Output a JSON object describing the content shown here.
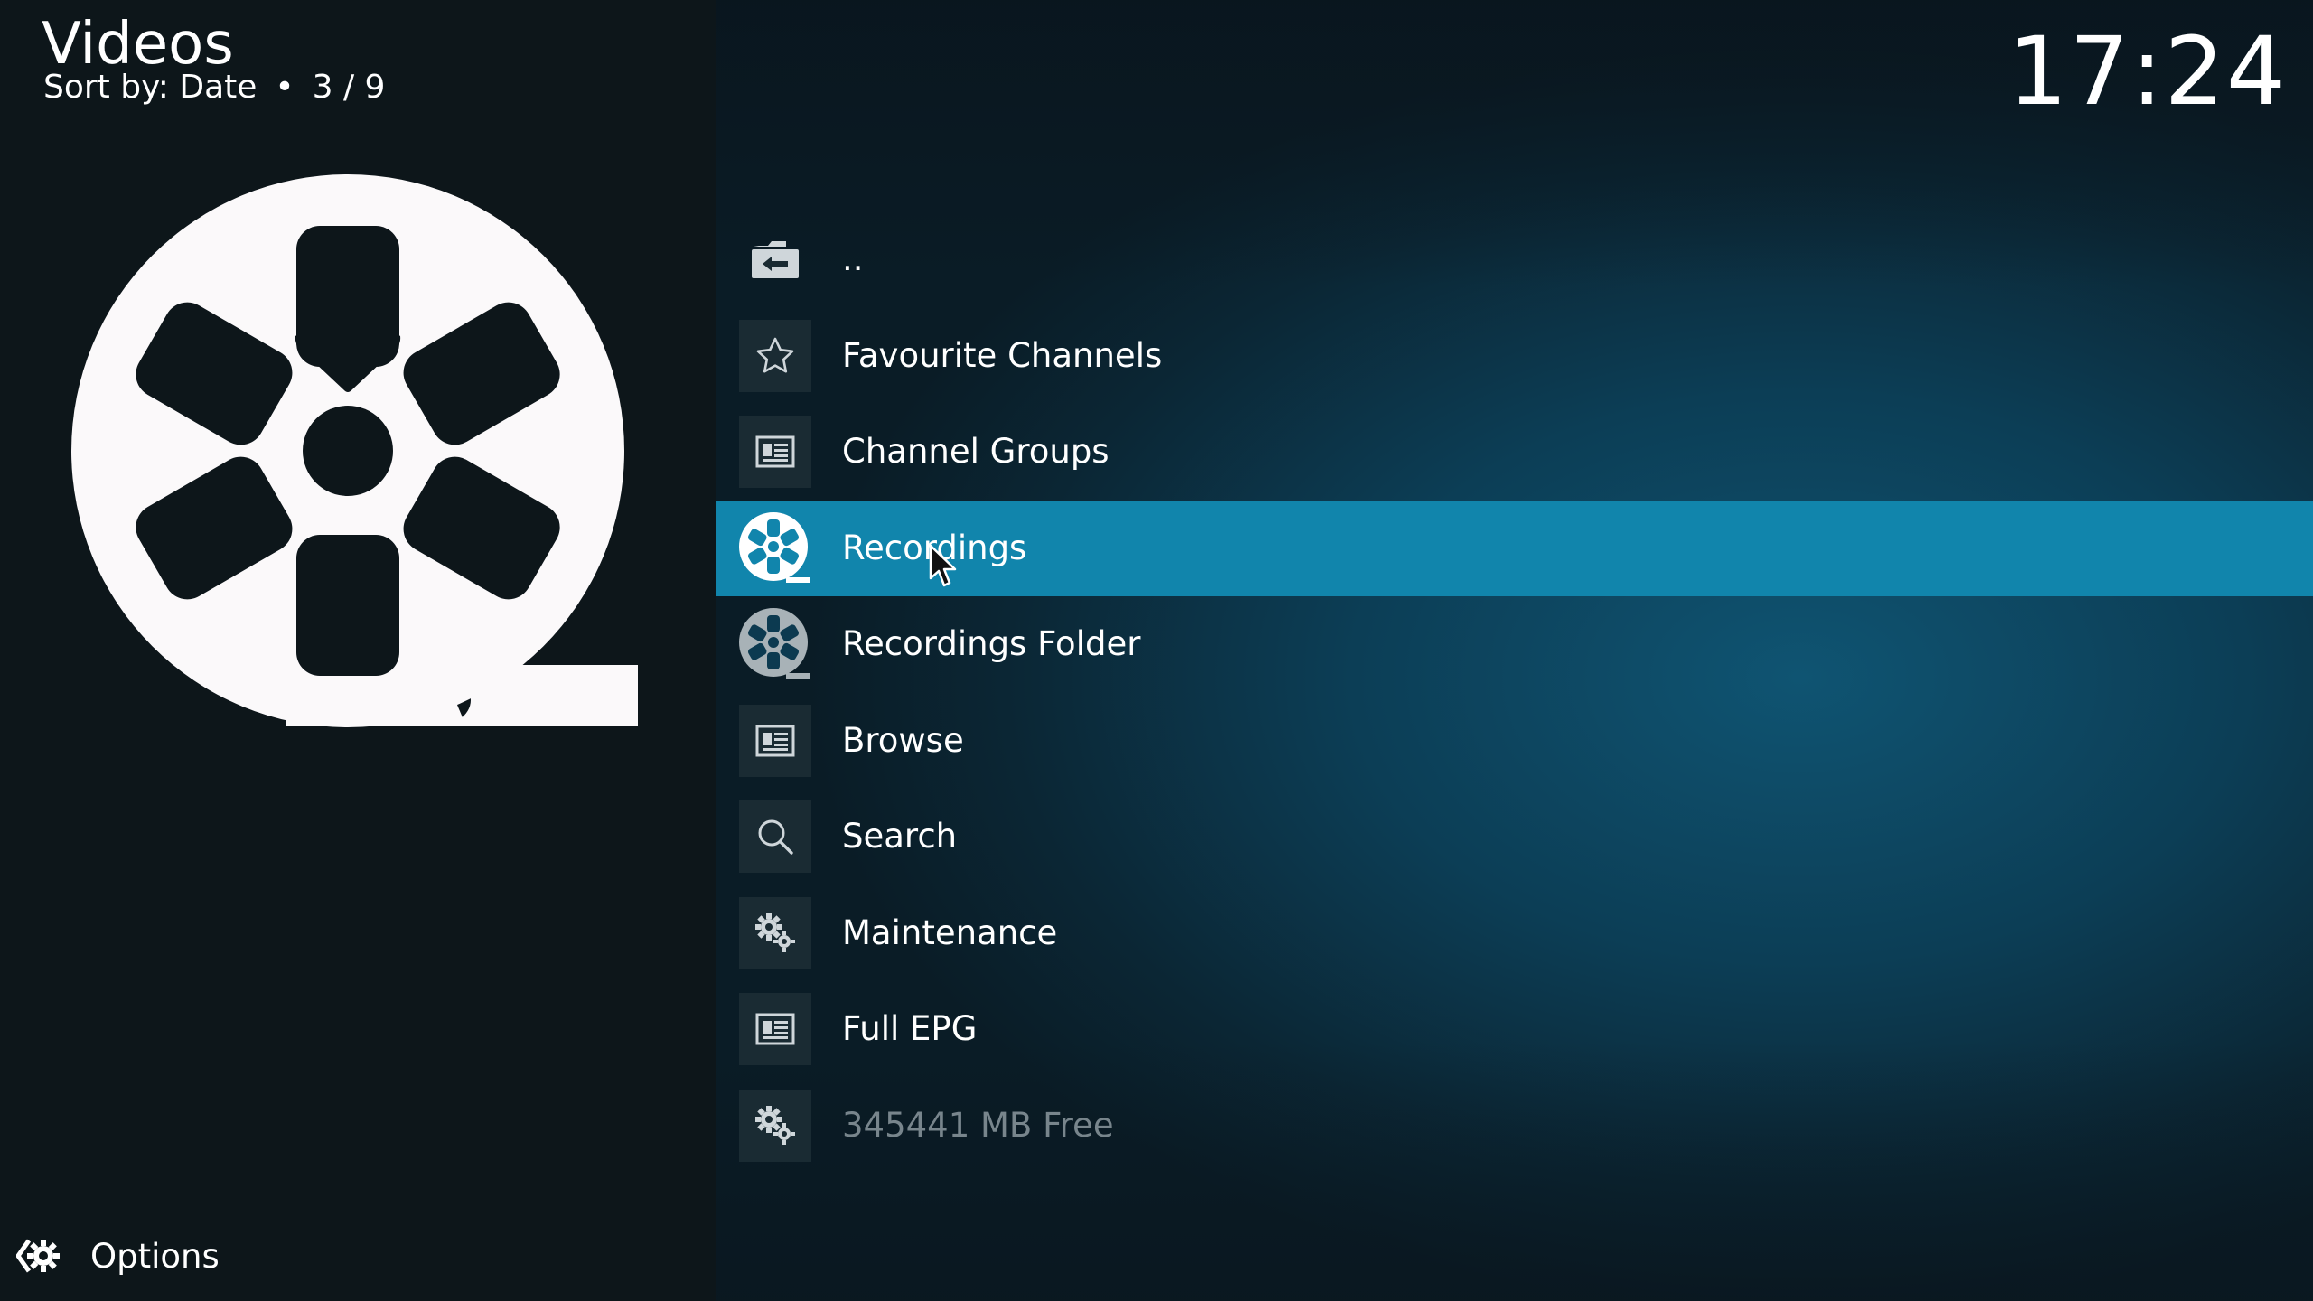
{
  "header": {
    "title": "Videos",
    "sort_label": "Sort by: Date",
    "separator": "•",
    "position": "3 / 9",
    "clock": "17:24"
  },
  "list": {
    "items": [
      {
        "label": "..",
        "icon": "folder-back-icon"
      },
      {
        "label": "Favourite Channels",
        "icon": "star-icon"
      },
      {
        "label": "Channel Groups",
        "icon": "list-icon"
      },
      {
        "label": "Recordings",
        "icon": "film-reel-icon",
        "selected": true
      },
      {
        "label": "Recordings Folder",
        "icon": "film-reel-icon"
      },
      {
        "label": "Browse",
        "icon": "list-icon"
      },
      {
        "label": "Search",
        "icon": "search-icon"
      },
      {
        "label": "Maintenance",
        "icon": "gears-icon"
      },
      {
        "label": "Full EPG",
        "icon": "list-icon"
      },
      {
        "label": "345441 MB Free",
        "icon": "gears-icon",
        "dimmed": true
      }
    ]
  },
  "footer": {
    "options_label": "Options"
  },
  "colors": {
    "selection": "#1185ac",
    "left_panel": "#0d161a",
    "dim_text": "#78858c"
  }
}
